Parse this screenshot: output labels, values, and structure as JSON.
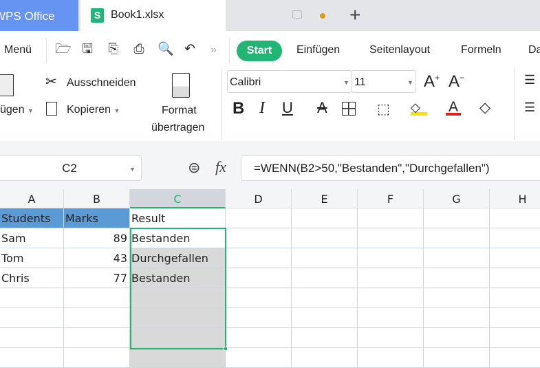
{
  "tabs": {
    "app": "WPS Office",
    "file": "Book1.xlsx",
    "new_tab": "+"
  },
  "toolbar": {
    "menu": "Menü",
    "more": "»",
    "ribbon_tabs": [
      "Start",
      "Einfügen",
      "Seitenlayout",
      "Formeln",
      "Da"
    ]
  },
  "ribbon": {
    "paste": "ügen",
    "cut": "Ausschneiden",
    "copy": "Kopieren",
    "format_line1": "Format",
    "format_line2": "übertragen",
    "font": "Calibri",
    "size": "11"
  },
  "formula_bar": {
    "name_box": "C2",
    "fx": "fx",
    "formula": "=WENN(B2>50,\"Bestanden\",\"Durchgefallen\")"
  },
  "sheet": {
    "columns": [
      "A",
      "B",
      "C",
      "D",
      "E",
      "F",
      "G",
      "H"
    ],
    "selected_column": "C",
    "rows": [
      [
        "Students",
        "Marks",
        "Result"
      ],
      [
        "Sam",
        "89",
        "Bestanden"
      ],
      [
        "Tom",
        "43",
        "Durchgefallen"
      ],
      [
        "Chris",
        "77",
        "Bestanden"
      ],
      [
        "",
        "",
        ""
      ],
      [
        "",
        "",
        ""
      ],
      [
        "",
        "",
        ""
      ],
      [
        "",
        "",
        ""
      ]
    ]
  },
  "colors": {
    "accent": "#22b573",
    "header_fill": "#5b9bd5",
    "selection_fill": "#d9d9d9"
  }
}
